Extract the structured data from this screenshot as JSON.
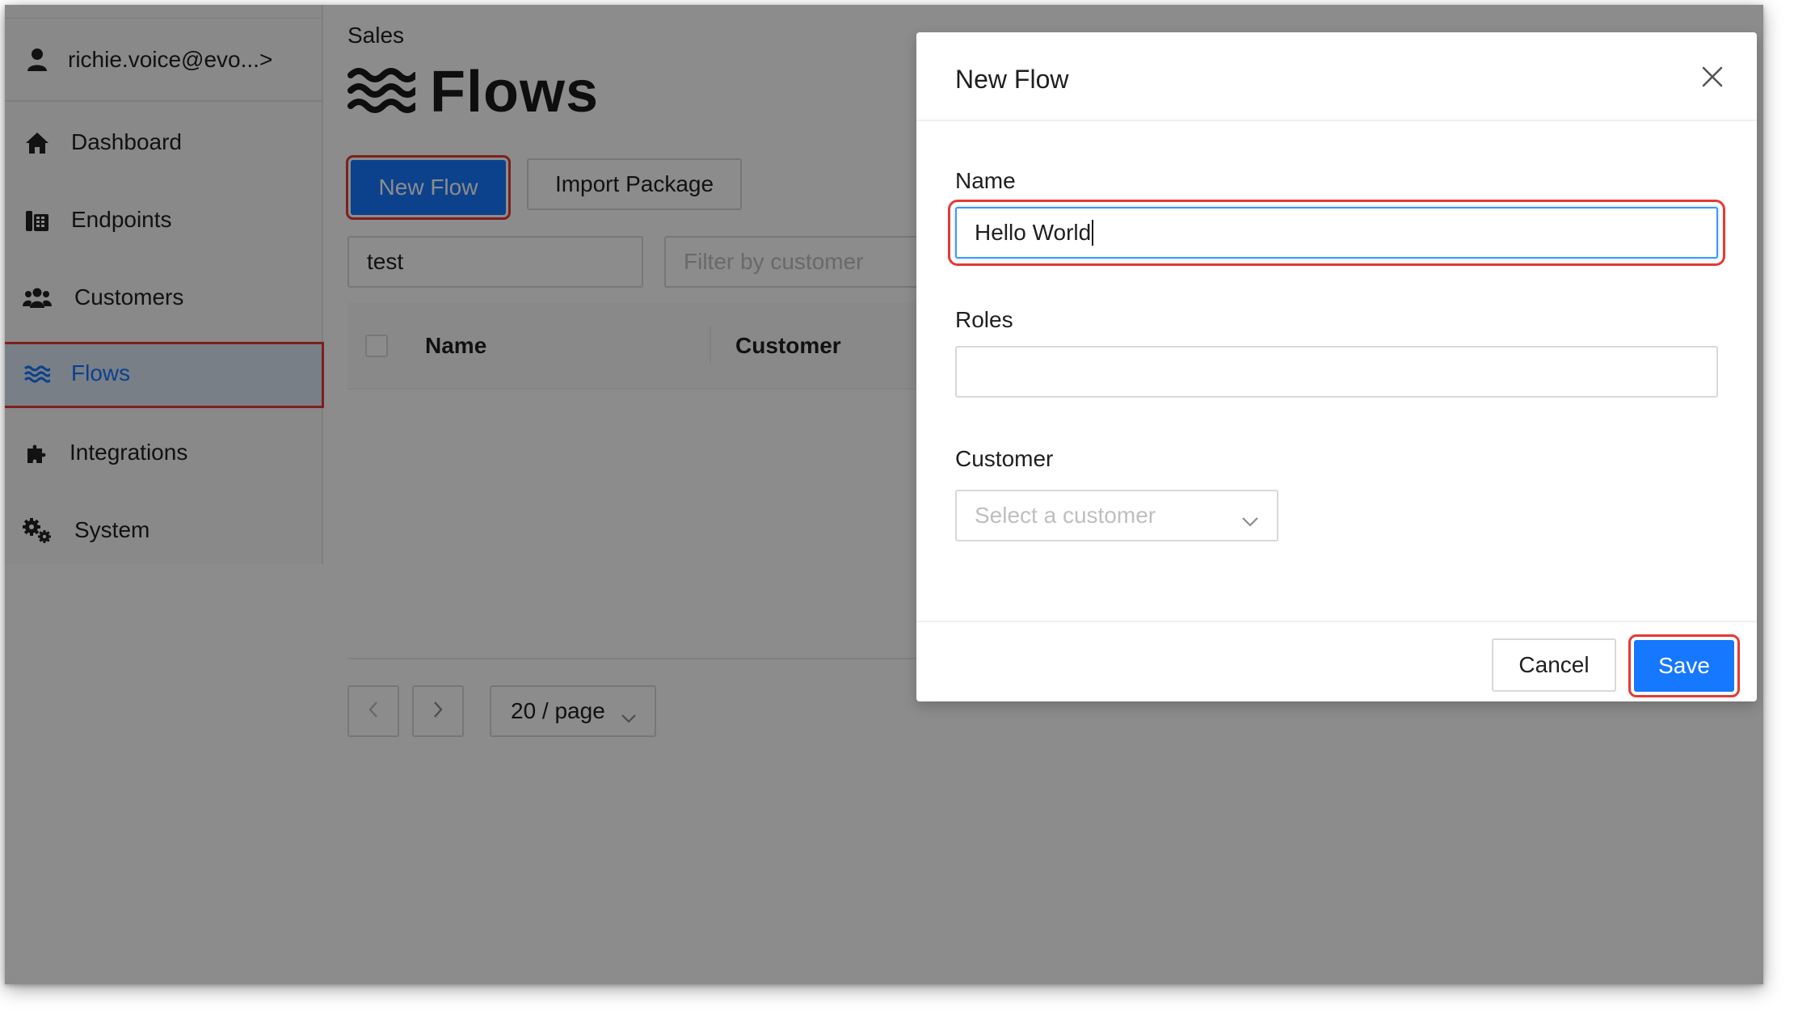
{
  "sidebar": {
    "user_label": "richie.voice@evo...>",
    "items": [
      {
        "label": "Dashboard",
        "icon": "home-icon"
      },
      {
        "label": "Endpoints",
        "icon": "endpoints-icon"
      },
      {
        "label": "Customers",
        "icon": "users-icon"
      },
      {
        "label": "Flows",
        "icon": "waves-icon"
      },
      {
        "label": "Integrations",
        "icon": "puzzle-icon"
      },
      {
        "label": "System",
        "icon": "gears-icon"
      }
    ]
  },
  "main": {
    "breadcrumb": "Sales",
    "title": "Flows",
    "new_flow_button": "New Flow",
    "import_button": "Import Package",
    "search_value": "test",
    "customer_filter_placeholder": "Filter by customer",
    "columns": [
      "Name",
      "Customer"
    ],
    "page_size": "20 / page"
  },
  "modal": {
    "title": "New Flow",
    "name_label": "Name",
    "name_value": "Hello World",
    "roles_label": "Roles",
    "roles_value": "",
    "customer_label": "Customer",
    "customer_placeholder": "Select a customer",
    "cancel_button": "Cancel",
    "save_button": "Save"
  },
  "colors": {
    "primary": "#1677ff",
    "highlight_box": "#e53935",
    "mask": "rgba(0,0,0,0.45)"
  }
}
